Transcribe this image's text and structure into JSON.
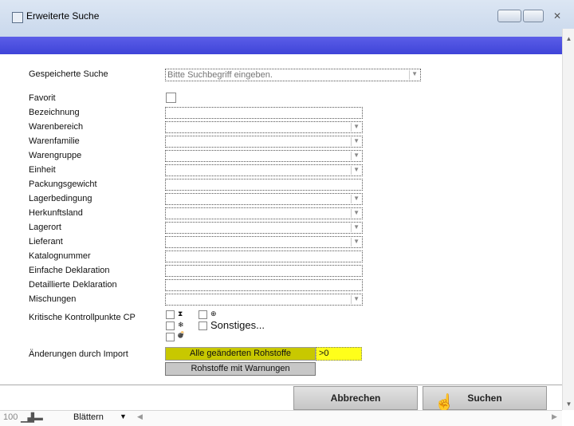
{
  "window": {
    "title": "Erweiterte Suche",
    "close_glyph": "✕",
    "colors": {
      "title_band": "#4a4fe0",
      "highlight_button": "#c8c800",
      "highlight_value": "#ffff1a",
      "secondary_button": "#c7c7c7"
    }
  },
  "form": {
    "saved_search": {
      "label": "Gespeicherte Suche",
      "placeholder": "Bitte Suchbegriff eingeben."
    },
    "fields": [
      {
        "label": "Favorit",
        "type": "checkbox"
      },
      {
        "label": "Bezeichnung",
        "type": "text"
      },
      {
        "label": "Warenbereich",
        "type": "dropdown"
      },
      {
        "label": "Warenfamilie",
        "type": "dropdown"
      },
      {
        "label": "Warengruppe",
        "type": "dropdown"
      },
      {
        "label": "Einheit",
        "type": "dropdown"
      },
      {
        "label": "Packungsgewicht",
        "type": "text"
      },
      {
        "label": "Lagerbedingung",
        "type": "dropdown"
      },
      {
        "label": "Herkunftsland",
        "type": "dropdown"
      },
      {
        "label": "Lagerort",
        "type": "dropdown"
      },
      {
        "label": "Lieferant",
        "type": "dropdown"
      },
      {
        "label": "Katalognummer",
        "type": "text"
      },
      {
        "label": "Einfache Deklaration",
        "type": "text"
      },
      {
        "label": "Detaillierte Deklaration",
        "type": "text"
      },
      {
        "label": "Mischungen",
        "type": "dropdown"
      }
    ],
    "dropdown_arrow": "▼",
    "kcp": {
      "label": "Kritische Kontrollpunkte CP",
      "options": [
        {
          "icon": "hourglass-icon",
          "glyph": "⧗"
        },
        {
          "icon": "crosshair-icon",
          "glyph": "⊕"
        },
        {
          "icon": "snowflake-icon",
          "glyph": "❄"
        },
        {
          "icon": "sonstiges",
          "glyph": "Sonstiges..."
        },
        {
          "icon": "bomb-icon",
          "glyph": "💣"
        }
      ]
    },
    "import_changes": {
      "label": "Änderungen durch Import",
      "changed_button": "Alle geänderten Rohstoffe",
      "changed_value": ">0",
      "warnings_button": "Rohstoffe mit Warnungen"
    }
  },
  "buttons": {
    "cancel": "Abbrechen",
    "search": "Suchen"
  },
  "statusbar": {
    "zoom": "100",
    "mode": "Blättern",
    "layout_icons": "▁▟▬",
    "mode_arrow": "▼",
    "scroll_left": "◀",
    "scroll_right": "▶",
    "scroll_up": "▲",
    "scroll_down": "▼"
  }
}
